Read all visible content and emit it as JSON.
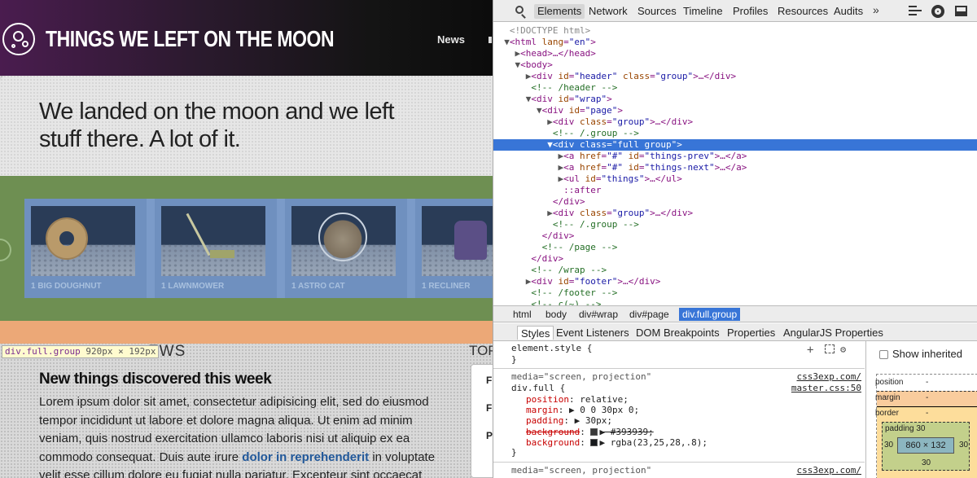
{
  "site": {
    "title": "THINGS WE LEFT ON THE MOON",
    "nav_news": "News",
    "hero_text": "We landed on the moon and we left stuff there. A lot of it.",
    "things": [
      {
        "label": "1 BIG DOUGHNUT",
        "icon": "doughnut"
      },
      {
        "label": "1 LAWNMOWER",
        "icon": "lawnmower"
      },
      {
        "label": "1 ASTRO CAT",
        "icon": "astro-cat"
      },
      {
        "label": "1 RECLINER",
        "icon": "recliner"
      }
    ],
    "highlight_label": {
      "selector": "div.full.group",
      "width": "920",
      "height": "192",
      "unit": "px",
      "times": "×"
    },
    "news_word": "EWS",
    "top_word": "TOP",
    "news_heading": "New things discovered this week",
    "news_body_1": "Lorem ipsum dolor sit amet, consectetur adipisicing elit, sed do eiusmod tempor incididunt ut labore et dolore magna aliqua. Ut enim ad minim veniam, quis nostrud exercitation ullamco laboris nisi ut aliquip ex ea commodo consequat. Duis aute irure ",
    "news_link": "dolor in reprehenderit",
    "news_body_2": " in voluptate velit esse cillum dolore eu fugiat nulla pariatur. Excepteur sint occaecat",
    "side_items": [
      "F",
      "F",
      "P"
    ]
  },
  "devtools": {
    "tabs": [
      "Elements",
      "Network",
      "Sources",
      "Timeline",
      "Profiles",
      "Resources",
      "Audits"
    ],
    "active_tab": "Elements",
    "more_tabs": "»",
    "dom": [
      {
        "indent": 0,
        "tri": "",
        "html": "<!DOCTYPE html>",
        "kind": "doctype"
      },
      {
        "indent": 0,
        "tri": "▼",
        "tag": "html",
        "attrs": [
          [
            "lang",
            "\"en\""
          ]
        ],
        "close": ">"
      },
      {
        "indent": 1,
        "tri": "▶",
        "tag": "head",
        "attrs": [],
        "close": ">…</head>"
      },
      {
        "indent": 1,
        "tri": "▼",
        "tag": "body",
        "attrs": [],
        "close": ">"
      },
      {
        "indent": 2,
        "tri": "▶",
        "tag": "div",
        "attrs": [
          [
            "id",
            "\"header\""
          ],
          [
            "class",
            "\"group\""
          ]
        ],
        "close": ">…</div>"
      },
      {
        "indent": 2,
        "tri": "",
        "comment": "<!-- /header -->"
      },
      {
        "indent": 2,
        "tri": "▼",
        "tag": "div",
        "attrs": [
          [
            "id",
            "\"wrap\""
          ]
        ],
        "close": ">"
      },
      {
        "indent": 3,
        "tri": "▼",
        "tag": "div",
        "attrs": [
          [
            "id",
            "\"page\""
          ]
        ],
        "close": ">"
      },
      {
        "indent": 4,
        "tri": "▶",
        "tag": "div",
        "attrs": [
          [
            "class",
            "\"group\""
          ]
        ],
        "close": ">…</div>"
      },
      {
        "indent": 4,
        "tri": "",
        "comment": "<!-- /.group -->"
      },
      {
        "indent": 4,
        "tri": "▼",
        "tag": "div",
        "attrs": [
          [
            "class",
            "\"full group\""
          ]
        ],
        "close": ">",
        "selected": true
      },
      {
        "indent": 5,
        "tri": "▶",
        "tag": "a",
        "attrs": [
          [
            "href",
            "\"#\""
          ],
          [
            "id",
            "\"things-prev\""
          ]
        ],
        "close": ">…</a>"
      },
      {
        "indent": 5,
        "tri": "▶",
        "tag": "a",
        "attrs": [
          [
            "href",
            "\"#\""
          ],
          [
            "id",
            "\"things-next\""
          ]
        ],
        "close": ">…</a>"
      },
      {
        "indent": 5,
        "tri": "▶",
        "tag": "ul",
        "attrs": [
          [
            "id",
            "\"things\""
          ]
        ],
        "close": ">…</ul>"
      },
      {
        "indent": 5,
        "tri": "",
        "pseudo": "::after"
      },
      {
        "indent": 4,
        "tri": "",
        "closing": "</div>"
      },
      {
        "indent": 4,
        "tri": "▶",
        "tag": "div",
        "attrs": [
          [
            "class",
            "\"group\""
          ]
        ],
        "close": ">…</div>"
      },
      {
        "indent": 4,
        "tri": "",
        "comment": "<!-- /.group -->"
      },
      {
        "indent": 3,
        "tri": "",
        "closing": "</div>"
      },
      {
        "indent": 3,
        "tri": "",
        "comment": "<!-- /page -->"
      },
      {
        "indent": 2,
        "tri": "",
        "closing": "</div>"
      },
      {
        "indent": 2,
        "tri": "",
        "comment": "<!-- /wrap -->"
      },
      {
        "indent": 2,
        "tri": "▶",
        "tag": "div",
        "attrs": [
          [
            "id",
            "\"footer\""
          ]
        ],
        "close": ">…</div>"
      },
      {
        "indent": 2,
        "tri": "",
        "comment": "<!-- /footer -->"
      },
      {
        "indent": 2,
        "tri": "",
        "comment": "<!-- c(~) -->"
      }
    ],
    "breadcrumbs": [
      "html",
      "body",
      "div#wrap",
      "div#page",
      "div.full.group"
    ],
    "active_crumb": "div.full.group",
    "sidebar_tabs": [
      "Styles",
      "Event Listeners",
      "DOM Breakpoints",
      "Properties",
      "AngularJS Properties"
    ],
    "active_sidebar_tab": "Styles",
    "styles": {
      "element_style": "element.style {",
      "close_brace": "}",
      "media_1": "media=\"screen, projection\"",
      "source_1": "css3exp.com/",
      "selector": "div.full {",
      "source_2": "master.css:50",
      "props": [
        {
          "name": "position",
          "value": "relative;"
        },
        {
          "name": "margin",
          "value": "▶ 0 0 30px 0;"
        },
        {
          "name": "padding",
          "value": "▶ 30px;"
        },
        {
          "name": "background",
          "value": "▶ #393939;",
          "swatch": "#393939",
          "struck": true
        },
        {
          "name": "background",
          "value": "▶ rgba(23,25,28,.8);",
          "swatch": "#17191c",
          "struck": false
        }
      ],
      "media_2": "media=\"screen, projection\"",
      "source_3": "css3exp.com/"
    },
    "metrics": {
      "show_inherited": "Show inherited",
      "position_label": "position",
      "position_value": "-",
      "margin_label": "margin",
      "margin_value": "-",
      "border_label": "border",
      "border_value": "-",
      "padding_label": "padding 30",
      "padding_left": "30",
      "padding_right": "30",
      "padding_bottom": "30",
      "content_size": "860 × 132"
    }
  }
}
